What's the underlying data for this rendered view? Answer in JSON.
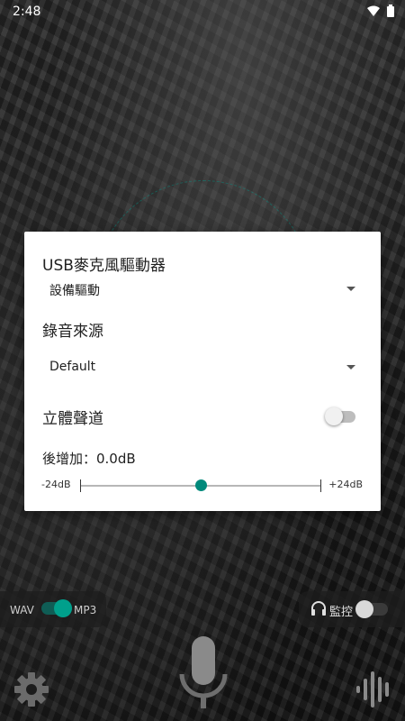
{
  "status_bar": {
    "time": "2:48"
  },
  "dialog": {
    "usb_driver_title": "USB麥克風驅動器",
    "usb_driver_value": "設備驅動",
    "source_title": "錄音來源",
    "source_value": "Default",
    "stereo_label": "立體聲道",
    "stereo_enabled": false,
    "gain_label": "後增加：0.0dB",
    "gain_min": "-24dB",
    "gain_max": "+24dB",
    "gain_value_db": 0.0
  },
  "controls": {
    "format_wav": "WAV",
    "format_mp3": "MP3",
    "format_mp3_selected": true,
    "monitor_label": "監控",
    "monitor_enabled": false
  },
  "icons": {
    "wifi": "wifi-icon",
    "battery": "battery-icon",
    "headphones": "headphones-icon",
    "settings": "gear-icon",
    "record": "microphone-icon",
    "waveform": "waveform-icon"
  },
  "colors": {
    "accent": "#00897b",
    "background": "#1a1a1a",
    "dialog": "#ffffff"
  }
}
